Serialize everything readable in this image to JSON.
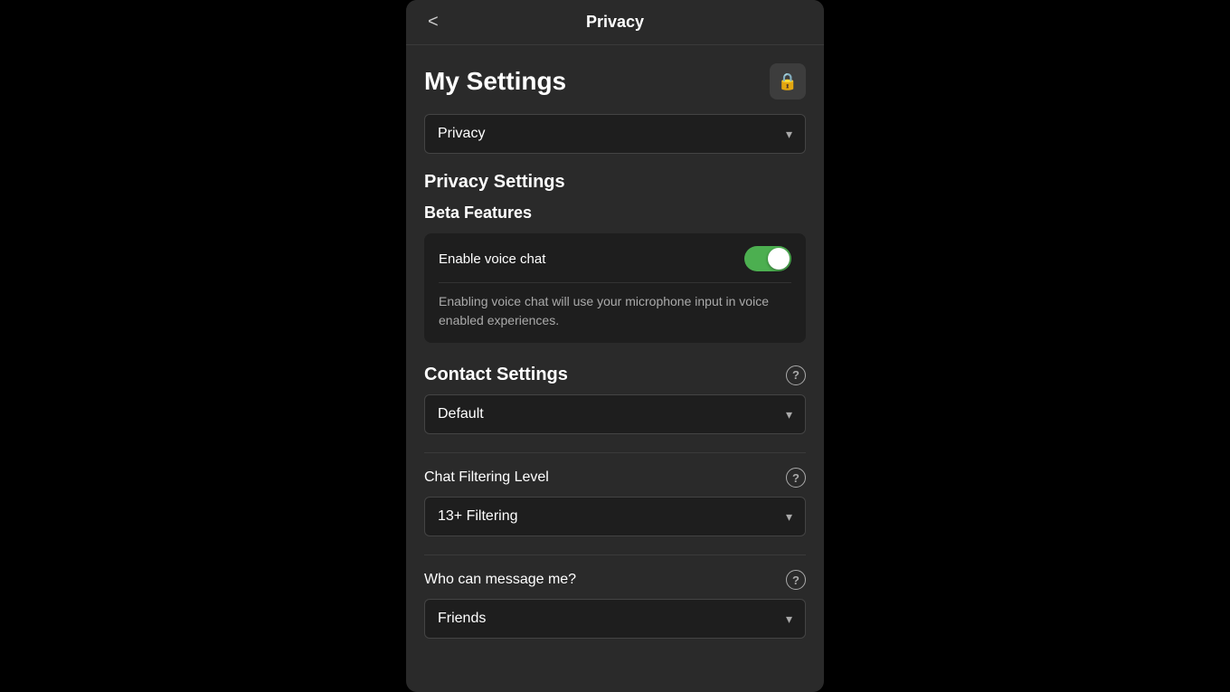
{
  "header": {
    "title": "Privacy",
    "back_label": "<"
  },
  "my_settings": {
    "title": "My Settings",
    "lock_icon": "🔒"
  },
  "privacy_dropdown": {
    "value": "Privacy",
    "chevron": "▾"
  },
  "privacy_settings": {
    "title": "Privacy Settings"
  },
  "beta_features": {
    "title": "Beta Features",
    "enable_voice_chat_label": "Enable voice chat",
    "enable_voice_chat_desc": "Enabling voice chat will use your microphone input in voice enabled experiences.",
    "toggle_state": "on"
  },
  "contact_settings": {
    "title": "Contact Settings",
    "dropdown_value": "Default",
    "chevron": "▾",
    "help": "?"
  },
  "chat_filtering": {
    "title": "Chat Filtering Level",
    "dropdown_value": "13+ Filtering",
    "chevron": "▾",
    "help": "?"
  },
  "who_message": {
    "title": "Who can message me?",
    "dropdown_value": "Friends",
    "chevron": "▾",
    "help": "?"
  }
}
